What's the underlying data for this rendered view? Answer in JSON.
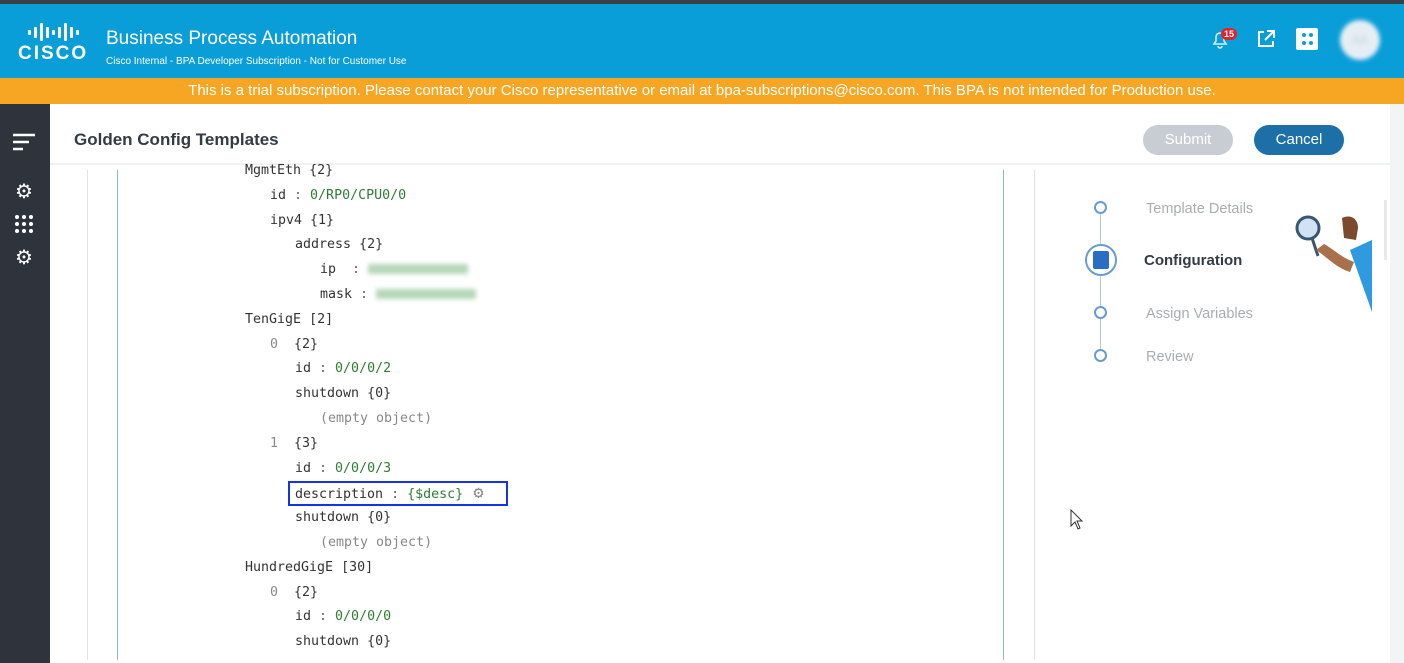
{
  "header": {
    "title": "Business Process Automation",
    "subtitle": "Cisco Internal - BPA Developer Subscription - Not for Customer Use",
    "logo_text": "CISCO",
    "notification_count": "15",
    "avatar_initials": "AA"
  },
  "banner": "This is a trial subscription. Please contact your Cisco representative or email at bpa-subscriptions@cisco.com. This BPA is not intended for Production use.",
  "page": {
    "title": "Golden Config Templates",
    "submit": "Submit",
    "cancel": "Cancel"
  },
  "steps": [
    {
      "label": "Template Details",
      "active": false
    },
    {
      "label": "Configuration",
      "active": true
    },
    {
      "label": "Assign Variables",
      "active": false
    },
    {
      "label": "Review",
      "active": false
    }
  ],
  "code_lines": [
    {
      "level": 0,
      "key": "MgmtEth",
      "meta": "{2}"
    },
    {
      "level": 1,
      "key": "id",
      "value": "0/RP0/CPU0/0"
    },
    {
      "level": 1,
      "key": "ipv4",
      "meta": "{1}"
    },
    {
      "level": 2,
      "key": "address",
      "meta": "{2}"
    },
    {
      "level": 3,
      "key": "ip ",
      "blurred": true
    },
    {
      "level": 3,
      "key": "mask",
      "blurred": true
    },
    {
      "level": 0,
      "key": "TenGigE",
      "meta": "[2]"
    },
    {
      "level": 1,
      "index": "0",
      "meta": "{2}"
    },
    {
      "level": 2,
      "key": "id",
      "value": "0/0/0/2"
    },
    {
      "level": 2,
      "key": "shutdown",
      "meta": "{0}"
    },
    {
      "level": 3,
      "note": "(empty object)"
    },
    {
      "level": 1,
      "index": "1",
      "meta": "{3}"
    },
    {
      "level": 2,
      "key": "id",
      "value": "0/0/0/3"
    },
    {
      "level": 2,
      "key": "description",
      "value": "{$desc}",
      "gear": true
    },
    {
      "level": 2,
      "key": "shutdown",
      "meta": "{0}"
    },
    {
      "level": 3,
      "note": "(empty object)"
    },
    {
      "level": 0,
      "key": "HundredGigE",
      "meta": "[30]"
    },
    {
      "level": 1,
      "index": "0",
      "meta": "{2}"
    },
    {
      "level": 2,
      "key": "id",
      "value": "0/0/0/0"
    },
    {
      "level": 2,
      "key": "shutdown",
      "meta": "{0}"
    }
  ]
}
